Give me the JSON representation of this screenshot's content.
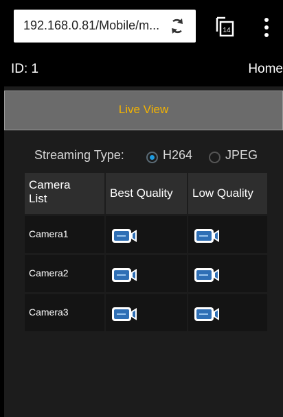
{
  "browser": {
    "url": "192.168.0.81/Mobile/m...",
    "tab_count": "14"
  },
  "header": {
    "id_label": "ID: 1",
    "home_link": "Home"
  },
  "live_view": {
    "label": "Live View"
  },
  "streaming": {
    "label": "Streaming Type:",
    "options": [
      {
        "label": "H264",
        "selected": true
      },
      {
        "label": "JPEG",
        "selected": false
      }
    ]
  },
  "camera_table": {
    "headers": [
      "Camera List",
      "Best Quality",
      "Low Quality"
    ],
    "rows": [
      {
        "name": "Camera1"
      },
      {
        "name": "Camera2"
      },
      {
        "name": "Camera3"
      }
    ]
  },
  "colors": {
    "accent": "#f5b400",
    "radio_selected": "#1e9be0",
    "camera_icon": "#2f6fb5"
  },
  "icons": {
    "reload": "reload-icon",
    "tabs": "tabs-icon",
    "menu": "overflow-menu-icon",
    "camera": "video-camera-icon"
  }
}
